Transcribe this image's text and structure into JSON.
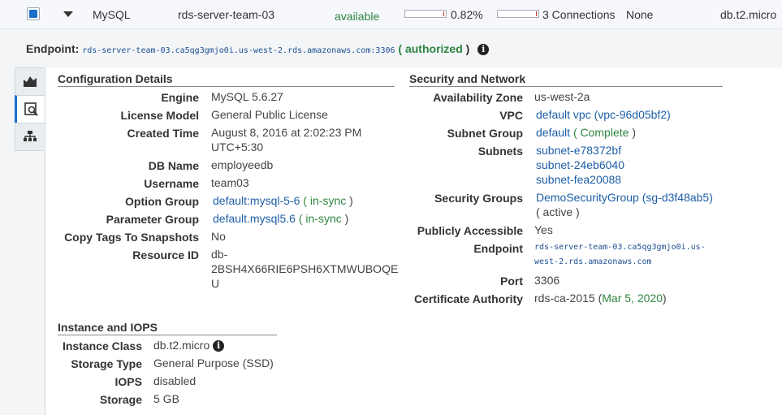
{
  "row": {
    "engine": "MySQL",
    "identifier": "rds-server-team-03",
    "status": "available",
    "cpu": "0.82%",
    "cpu_level": 0.0082,
    "connections": "3 Connections",
    "replication": "None",
    "class": "db.t2.micro"
  },
  "endpoint": {
    "label": "Endpoint:",
    "value": "rds-server-team-03.ca5qg3gmjo0i.us-west-2.rds.amazonaws.com:3306",
    "open": "(",
    "status": "authorized",
    "close": ")"
  },
  "tabs": [
    {
      "icon": "chart-icon"
    },
    {
      "icon": "details-icon"
    },
    {
      "icon": "hierarchy-icon"
    }
  ],
  "config": {
    "title": "Configuration Details",
    "engine_k": "Engine",
    "engine_v": "MySQL 5.6.27",
    "license_k": "License Model",
    "license_v": "General Public License",
    "created_k": "Created Time",
    "created_v1": "August 8, 2016 at 2:02:23 PM",
    "created_v2": "UTC+5:30",
    "dbname_k": "DB Name",
    "dbname_v": "employeedb",
    "user_k": "Username",
    "user_v": "team03",
    "optgroup_k": "Option Group",
    "optgroup_v": "default:mysql-5-6",
    "optgroup_s": "in-sync",
    "paramgroup_k": "Parameter Group",
    "paramgroup_v": "default.mysql5.6",
    "paramgroup_s": "in-sync",
    "copytags_k": "Copy Tags To Snapshots",
    "copytags_v": "No",
    "resid_k": "Resource ID",
    "resid_v1": "db-",
    "resid_v2": "2BSH4X66RIE6PSH6XTMWUBOQE",
    "resid_v3": "U"
  },
  "instance": {
    "title": "Instance and IOPS",
    "class_k": "Instance Class",
    "class_v": "db.t2.micro",
    "stype_k": "Storage Type",
    "stype_v": "General Purpose (SSD)",
    "iops_k": "IOPS",
    "iops_v": "disabled",
    "storage_k": "Storage",
    "storage_v": "5 GB"
  },
  "security": {
    "title": "Security and Network",
    "az_k": "Availability Zone",
    "az_v": "us-west-2a",
    "vpc_k": "VPC",
    "vpc_v": "default vpc (vpc-96d05bf2)",
    "subgrp_k": "Subnet Group",
    "subgrp_v": "default",
    "subgrp_s": "Complete",
    "subnets_k": "Subnets",
    "subnets": [
      "subnet-e78372bf",
      "subnet-24eb6040",
      "subnet-fea20088"
    ],
    "sg_k": "Security Groups",
    "sg_v": "DemoSecurityGroup (sg-d3f48ab5)",
    "sg_s": "( active )",
    "public_k": "Publicly Accessible",
    "public_v": "Yes",
    "endpoint_k": "Endpoint",
    "endpoint_v1": "rds-server-team-03.ca5qg3gmjo0i.us-",
    "endpoint_v2": "west-2.rds.amazonaws.com",
    "port_k": "Port",
    "port_v": "3306",
    "ca_k": "Certificate Authority",
    "ca_v": "rds-ca-2015",
    "ca_date": "Mar 5, 2020"
  }
}
